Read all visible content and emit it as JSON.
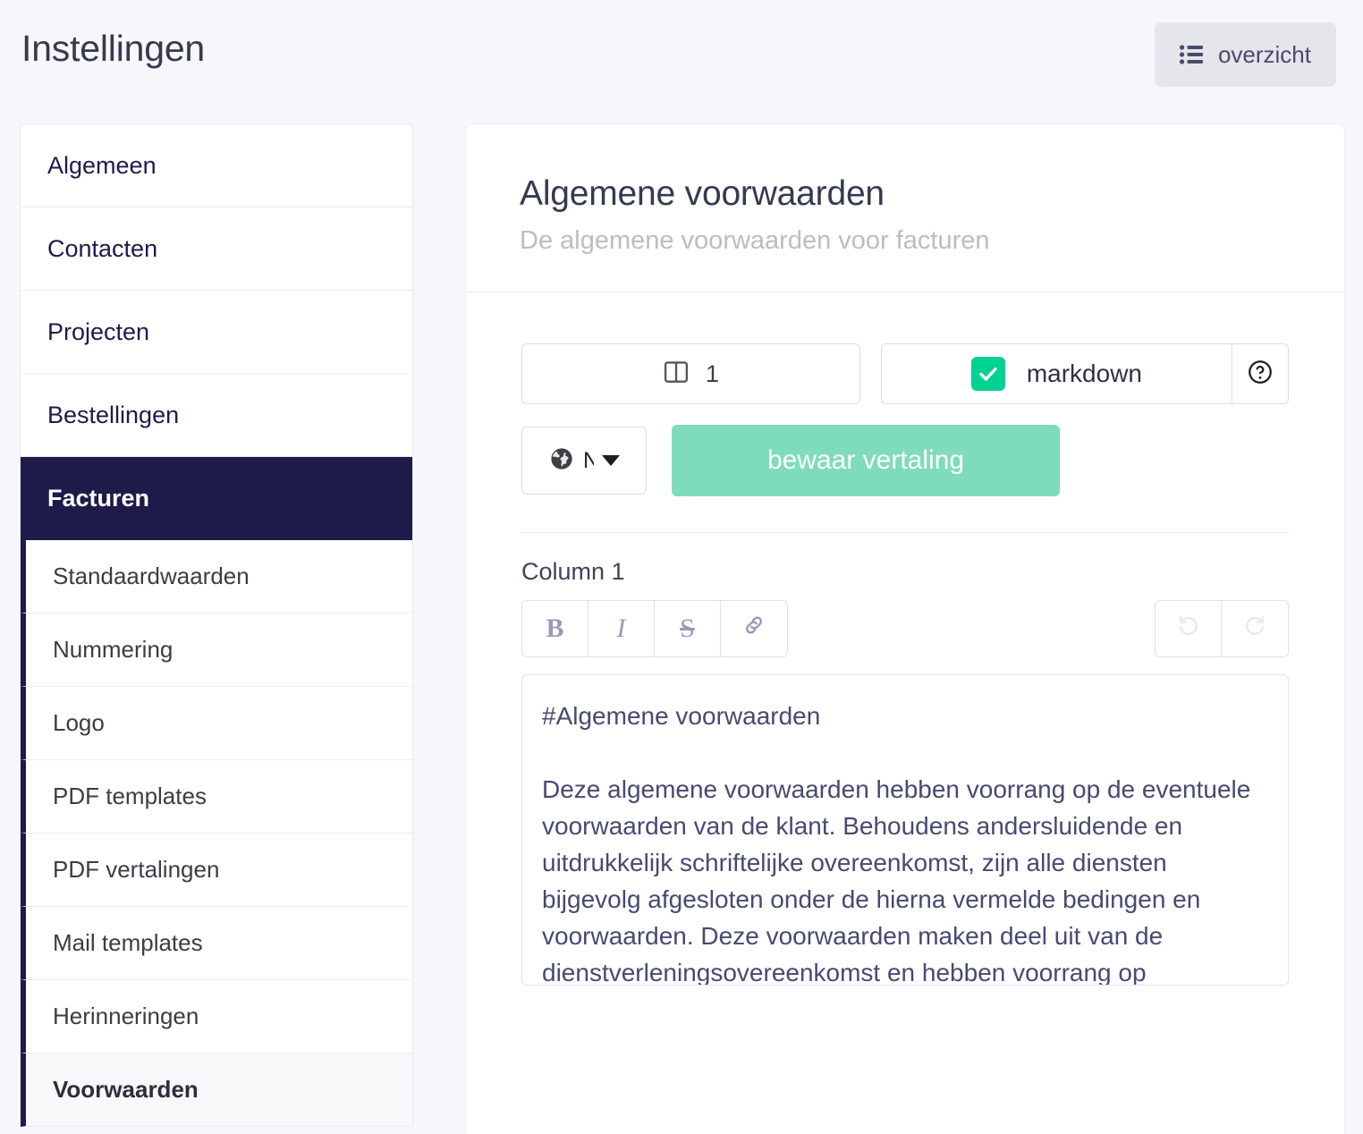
{
  "header": {
    "title": "Instellingen",
    "overview_button": {
      "label": "overzicht",
      "icon": "list-icon"
    }
  },
  "sidebar": {
    "items": [
      {
        "label": "Algemeen",
        "active": false
      },
      {
        "label": "Contacten",
        "active": false
      },
      {
        "label": "Projecten",
        "active": false
      },
      {
        "label": "Bestellingen",
        "active": false
      },
      {
        "label": "Facturen",
        "active": true
      }
    ],
    "subitems": [
      {
        "label": "Standaardwaarden",
        "active": false
      },
      {
        "label": "Nummering",
        "active": false
      },
      {
        "label": "Logo",
        "active": false
      },
      {
        "label": "PDF templates",
        "active": false
      },
      {
        "label": "PDF vertalingen",
        "active": false
      },
      {
        "label": "Mail templates",
        "active": false
      },
      {
        "label": "Herinneringen",
        "active": false
      },
      {
        "label": "Voorwaarden",
        "active": true
      }
    ]
  },
  "panel": {
    "title": "Algemene voorwaarden",
    "subtitle": "De algemene voorwaarden voor facturen",
    "controls": {
      "columns_icon": "columns-icon",
      "columns_value": "1",
      "markdown_label": "markdown",
      "markdown_checked": true,
      "help_icon": "help-circle-icon",
      "language_icon": "globe-icon",
      "language_value": "N",
      "save_label": "bewaar vertaling"
    },
    "editor": {
      "column_label": "Column 1",
      "toolbar": {
        "bold": "B",
        "italic": "I",
        "strikethrough": "S",
        "link_icon": "link-icon",
        "undo_icon": "undo-icon",
        "redo_icon": "redo-icon"
      },
      "content": "#Algemene voorwaarden\n\nDeze algemene voorwaarden hebben voorrang op de eventuele voorwaarden van de klant. Behoudens andersluidende en uitdrukkelijk schriftelijke overeenkomst, zijn alle diensten bijgevolg afgesloten onder de hierna vermelde bedingen en voorwaarden. Deze voorwaarden maken deel uit van de dienstverleningsovereenkomst en hebben voorrang op"
    }
  },
  "colors": {
    "page_background": "#f7f7fb",
    "sidebar_active": "#1e1b4b",
    "checkbox_green": "#00d391",
    "save_button_green": "#7fdcba",
    "title_text": "#373a4d",
    "subtitle_text": "#bcbcc6",
    "editor_text": "#474a70"
  }
}
